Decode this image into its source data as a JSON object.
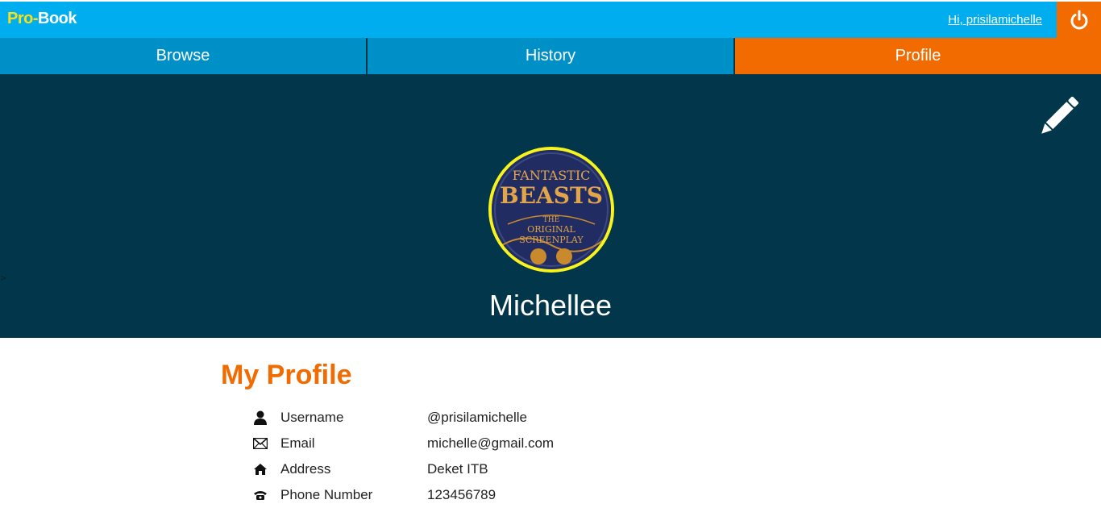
{
  "header": {
    "logo_pro": "Pro",
    "logo_dash": "-",
    "logo_book": "Book",
    "greeting": "Hi, prisilamichelle",
    "logout_icon": "power-icon"
  },
  "nav": {
    "tabs": [
      {
        "label": "Browse",
        "active": false
      },
      {
        "label": "History",
        "active": false
      },
      {
        "label": "Profile",
        "active": true
      }
    ]
  },
  "hero": {
    "name": "Michellee",
    "edit_icon": "pencil-icon",
    "avatar": {
      "line1": "FANTASTIC",
      "line2": "BEASTS",
      "line3": "THE",
      "line4": "ORIGINAL",
      "line5": "SCREENPLAY"
    },
    "stray_char": ">"
  },
  "profile": {
    "title": "My Profile",
    "rows": [
      {
        "icon": "user-icon",
        "label": "Username",
        "value": "@prisilamichelle"
      },
      {
        "icon": "envelope-icon",
        "label": "Email",
        "value": "michelle@gmail.com"
      },
      {
        "icon": "home-icon",
        "label": "Address",
        "value": "Deket ITB"
      },
      {
        "icon": "phone-icon",
        "label": "Phone Number",
        "value": "123456789"
      }
    ]
  },
  "colors": {
    "topbar": "#00aeef",
    "nav": "#0090c8",
    "accent": "#f26b00",
    "hero": "#02364b",
    "logo_yellow": "#f7e11b"
  }
}
